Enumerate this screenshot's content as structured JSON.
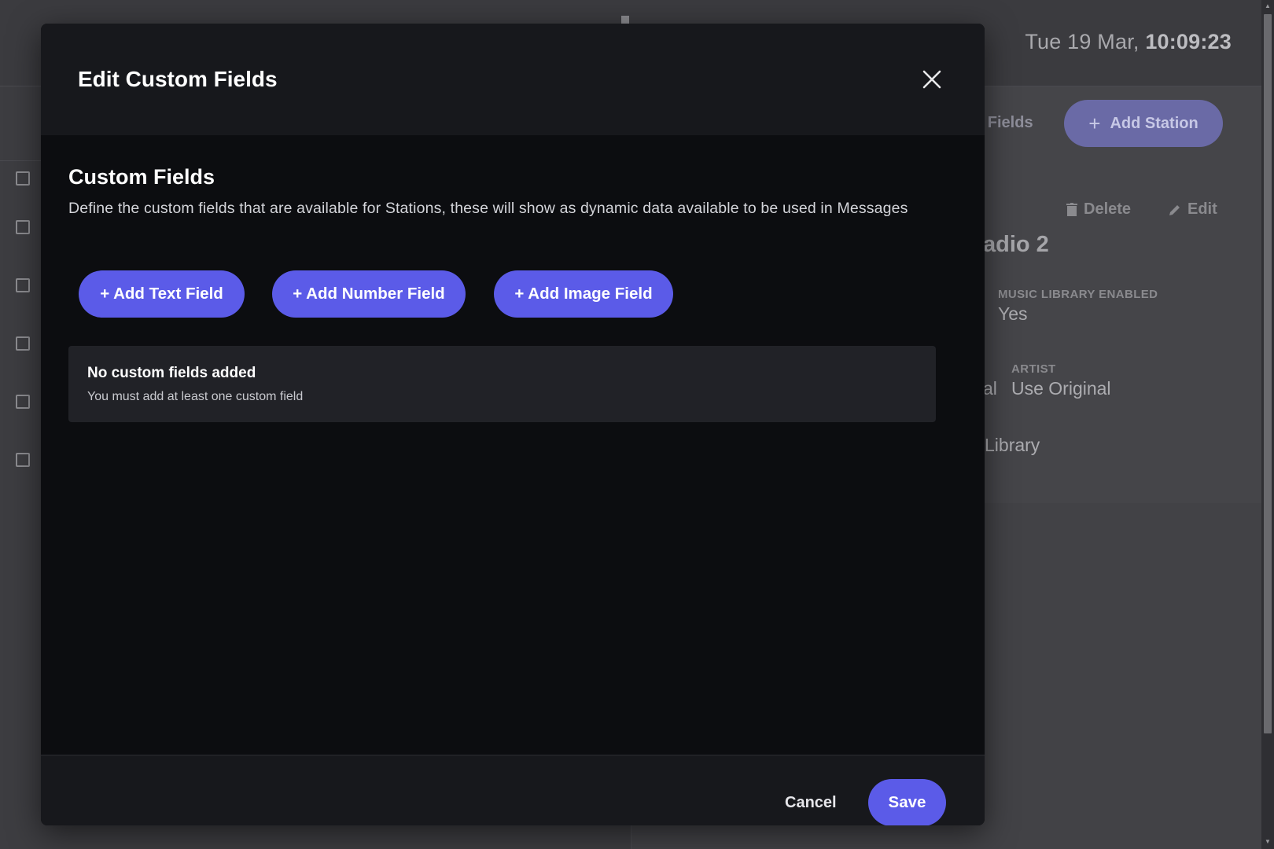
{
  "background": {
    "clock_date": "Tue 19 Mar,",
    "clock_time": "10:09:23",
    "fields_link": "n Fields",
    "add_station_label": "Add Station",
    "delete_label": "Delete",
    "edit_label": "Edit",
    "station_name": "adio 2",
    "music_library_label": "MUSIC LIBRARY ENABLED",
    "music_library_value": "Yes",
    "artist_label": "ARTIST",
    "artist_value": "Use Original",
    "partial_value": "al",
    "library_value": "Library"
  },
  "modal": {
    "title": "Edit Custom Fields",
    "section_title": "Custom Fields",
    "section_description": "Define the custom fields that are available for Stations, these will show as dynamic data available to be used in Messages",
    "buttons": {
      "add_text": "+ Add Text Field",
      "add_number": "+ Add Number Field",
      "add_image": "+ Add Image Field"
    },
    "empty_state": {
      "title": "No custom fields added",
      "description": "You must add at least one custom field"
    },
    "footer": {
      "cancel_label": "Cancel",
      "save_label": "Save"
    }
  },
  "colors": {
    "accent": "#5b5be8",
    "modal_bg": "#0c0d10",
    "modal_header_bg": "#17181c",
    "empty_box_bg": "#212227"
  }
}
